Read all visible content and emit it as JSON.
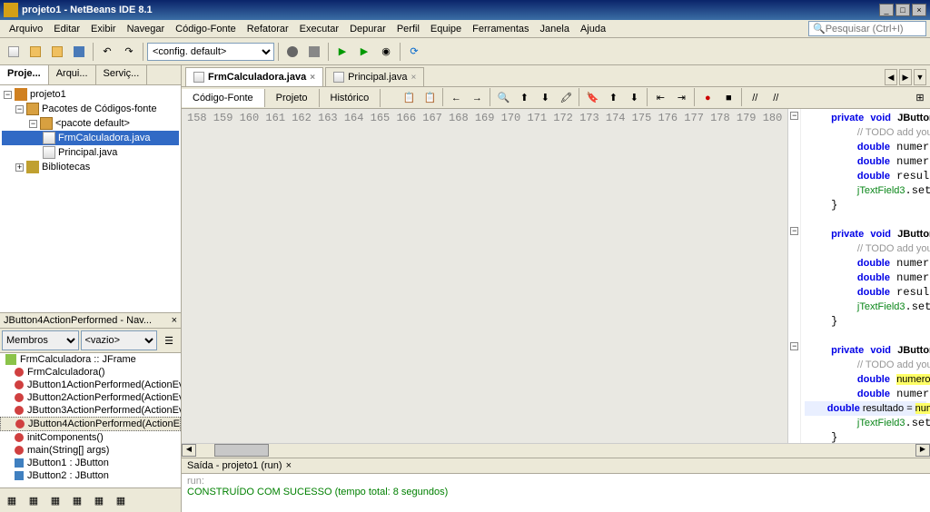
{
  "window": {
    "title": "projeto1 - NetBeans IDE 8.1"
  },
  "menu": {
    "items": [
      "Arquivo",
      "Editar",
      "Exibir",
      "Navegar",
      "Código-Fonte",
      "Refatorar",
      "Executar",
      "Depurar",
      "Perfil",
      "Equipe",
      "Ferramentas",
      "Janela",
      "Ajuda"
    ]
  },
  "search": {
    "placeholder": "Pesquisar (Ctrl+I)"
  },
  "toolbar": {
    "config": "<config. default>"
  },
  "projects": {
    "tabs": [
      "Proje...",
      "Arqui...",
      "Serviç..."
    ],
    "root": "projeto1",
    "folder1": "Pacotes de Códigos-fonte",
    "pkg": "<pacote default>",
    "file1": "FrmCalculadora.java",
    "file2": "Principal.java",
    "libs": "Bibliotecas"
  },
  "navigator": {
    "title": "JButton4ActionPerformed - Nav...",
    "filter1": "Membros",
    "filter2": "<vazio>",
    "class": "FrmCalculadora :: JFrame",
    "items": [
      "FrmCalculadora()",
      "JButton1ActionPerformed(ActionEv",
      "JButton2ActionPerformed(ActionEv",
      "JButton3ActionPerformed(ActionEv",
      "JButton4ActionPerformed(ActionEv",
      "initComponents()",
      "main(String[] args)",
      "JButton1 : JButton",
      "JButton2 : JButton"
    ],
    "selected_index": 4
  },
  "editor": {
    "tabs": [
      {
        "name": "FrmCalculadora.java",
        "active": true
      },
      {
        "name": "Principal.java",
        "active": false
      }
    ],
    "subtabs": [
      "Código-Fonte",
      "Projeto",
      "Histórico"
    ],
    "lines": {
      "start": 158,
      "end": 180
    }
  },
  "output": {
    "title": "Saída - projeto1 (run)",
    "run": "run:",
    "message": "CONSTRUÍDO COM SUCESSO (tempo total: 8 segundos)"
  }
}
